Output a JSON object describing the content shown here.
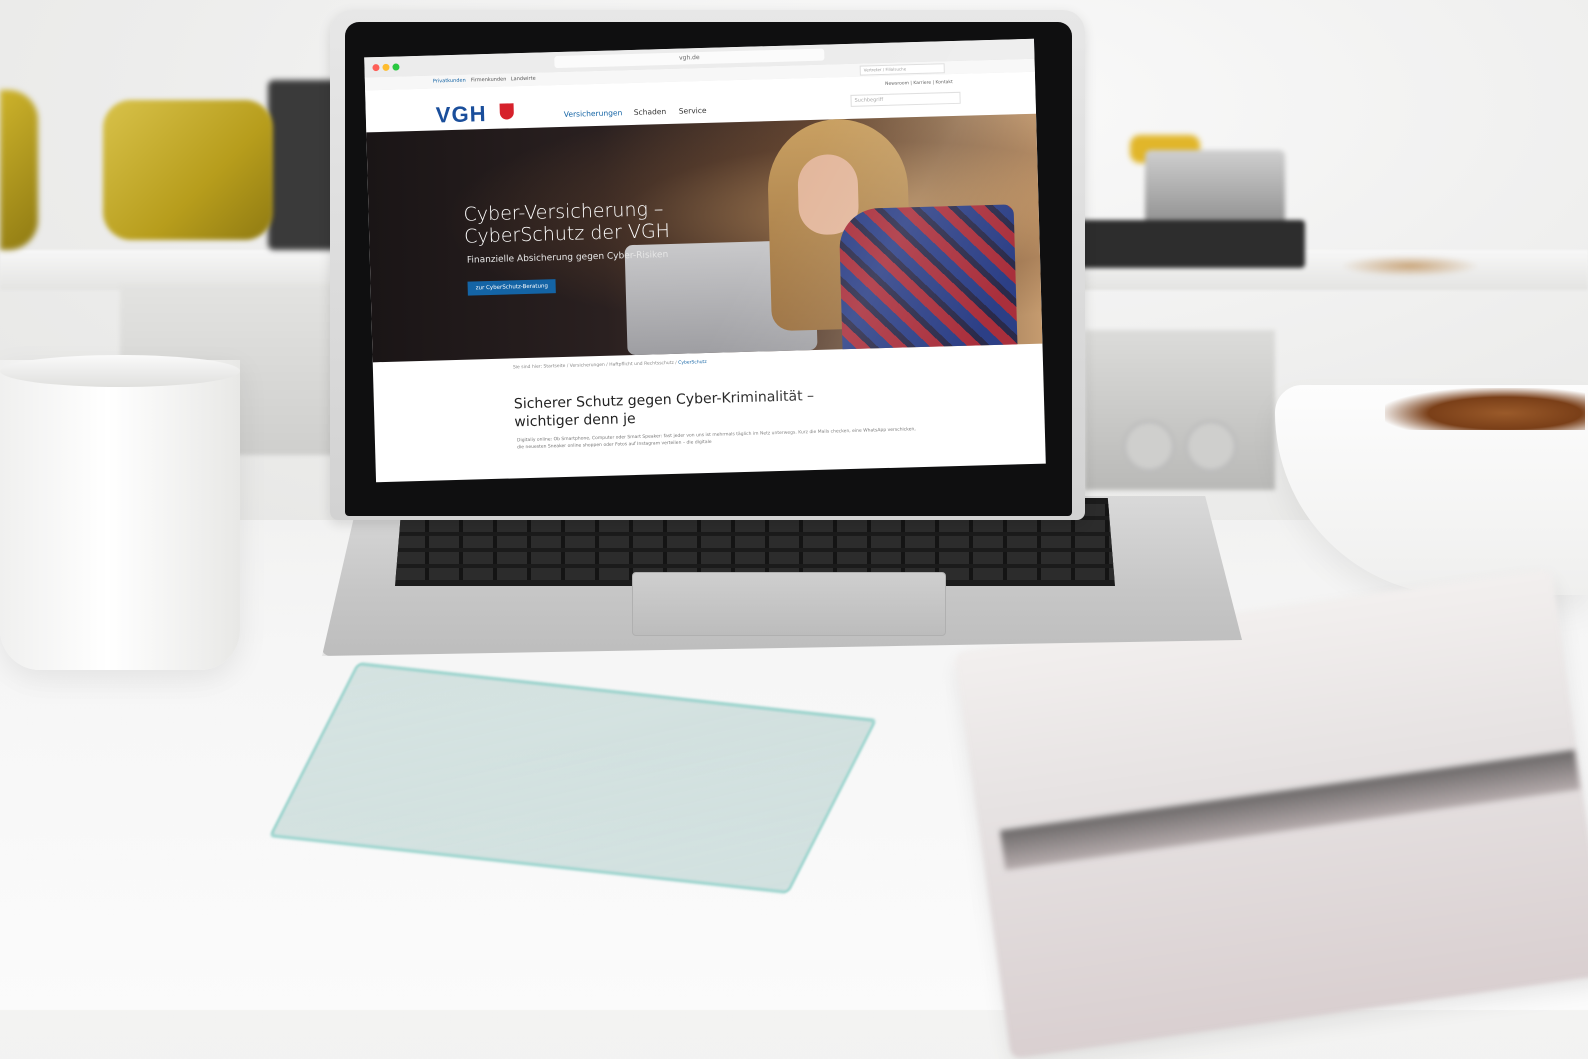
{
  "browser": {
    "address": "vgh.de",
    "tabs": [
      "Privatkunden",
      "Firmenkunden",
      "Landwirte"
    ],
    "active_tab_index": 0,
    "top_search_placeholder": "Vertreter / Filialsuche"
  },
  "site": {
    "logo_text": "VGH",
    "nav": [
      "Versicherungen",
      "Schaden",
      "Service"
    ],
    "active_nav_index": 0,
    "meta_links": "Newsroom | Karriere | Kontakt",
    "search_placeholder": "Suchbegriff"
  },
  "hero": {
    "title_line1": "Cyber-Versicherung –",
    "title_line2": "CyberSchutz der VGH",
    "subtitle": "Finanzielle Absicherung gegen Cyber-Risiken",
    "button_label": "zur CyberSchutz-Beratung"
  },
  "breadcrumb": {
    "items": "Sie sind hier: Startseite / Versicherungen / Haftpflicht und Rechtsschutz /",
    "current": "CyberSchutz"
  },
  "content": {
    "title_line1": "Sicherer Schutz gegen Cyber-Kriminalität –",
    "title_line2": "wichtiger denn je",
    "text": "Digitaliy online: Ob Smartphone, Computer oder Smart Speaker: fast jeder von uns ist mehrmals täglich im Netz unterwegs. Kurz die Mails checken, eine WhatsApp verschicken, die neuesten Sneaker online shoppen oder Fotos auf Instagram verteilen – die digitale"
  },
  "colors": {
    "brand_blue": "#1464a5",
    "logo_blue": "#1a4e9b",
    "logo_red": "#d6212b"
  }
}
